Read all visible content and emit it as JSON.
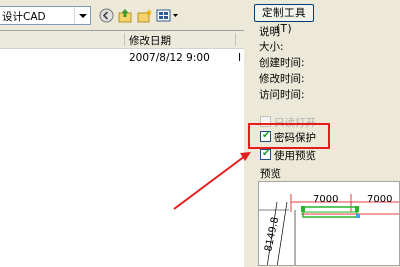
{
  "toolbar": {
    "look_in_value": "设计CAD",
    "icons": [
      "back-arrow-icon",
      "up-folder-icon",
      "new-folder-icon",
      "views-menu-icon"
    ]
  },
  "file_list": {
    "columns": [
      "修改日期"
    ],
    "rows": [
      {
        "modified": "2007/8/12 9:00",
        "extra": "I"
      }
    ]
  },
  "right_panel": {
    "tools_button": "定制工具(T)",
    "description_label": "说明",
    "size_label": "大小:",
    "created_label": "创建时间:",
    "modified_label": "修改时间:",
    "accessed_label": "访问时间:",
    "checkboxes": [
      {
        "label": "只读打开",
        "checked": false,
        "enabled": false
      },
      {
        "label": "密码保护",
        "checked": true,
        "enabled": true
      },
      {
        "label": "使用预览",
        "checked": true,
        "enabled": true
      }
    ],
    "preview_label": "预览",
    "preview_dimensions": [
      "7000",
      "7000",
      "8149.8"
    ]
  },
  "annotation": {
    "color": "#e41c1c"
  }
}
